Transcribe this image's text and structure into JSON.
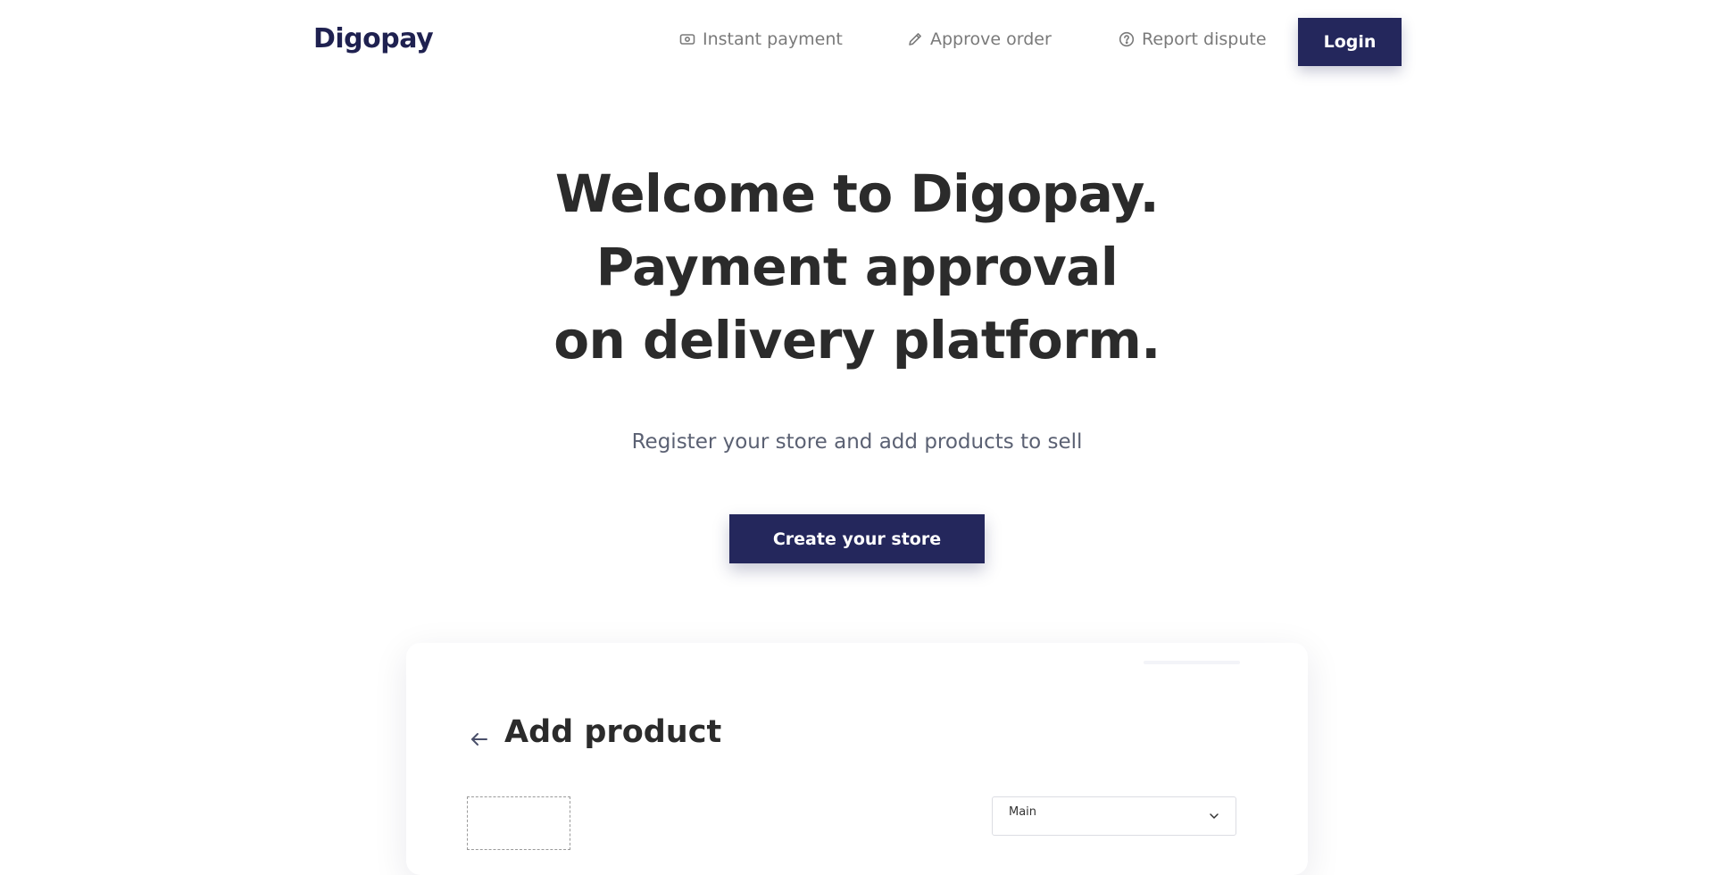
{
  "brand": {
    "name": "Digopay"
  },
  "nav": {
    "links": [
      {
        "label": "Instant payment",
        "icon": "money-icon"
      },
      {
        "label": "Approve order",
        "icon": "pencil-icon"
      },
      {
        "label": "Report dispute",
        "icon": "question-circle-icon"
      }
    ],
    "login_label": "Login"
  },
  "hero": {
    "line1": "Welcome to Digopay.",
    "line2": "Payment approval",
    "line3": "on delivery platform.",
    "subtitle": "Register your store and add products to sell",
    "cta_label": "Create your store"
  },
  "preview": {
    "title": "Add product",
    "back_icon": "arrow-left-icon",
    "select_value": "Main"
  },
  "colors": {
    "primary": "#24275c",
    "accent": "#f7cf0d",
    "text": "#2b2b2b",
    "muted": "#7a7a7a"
  }
}
